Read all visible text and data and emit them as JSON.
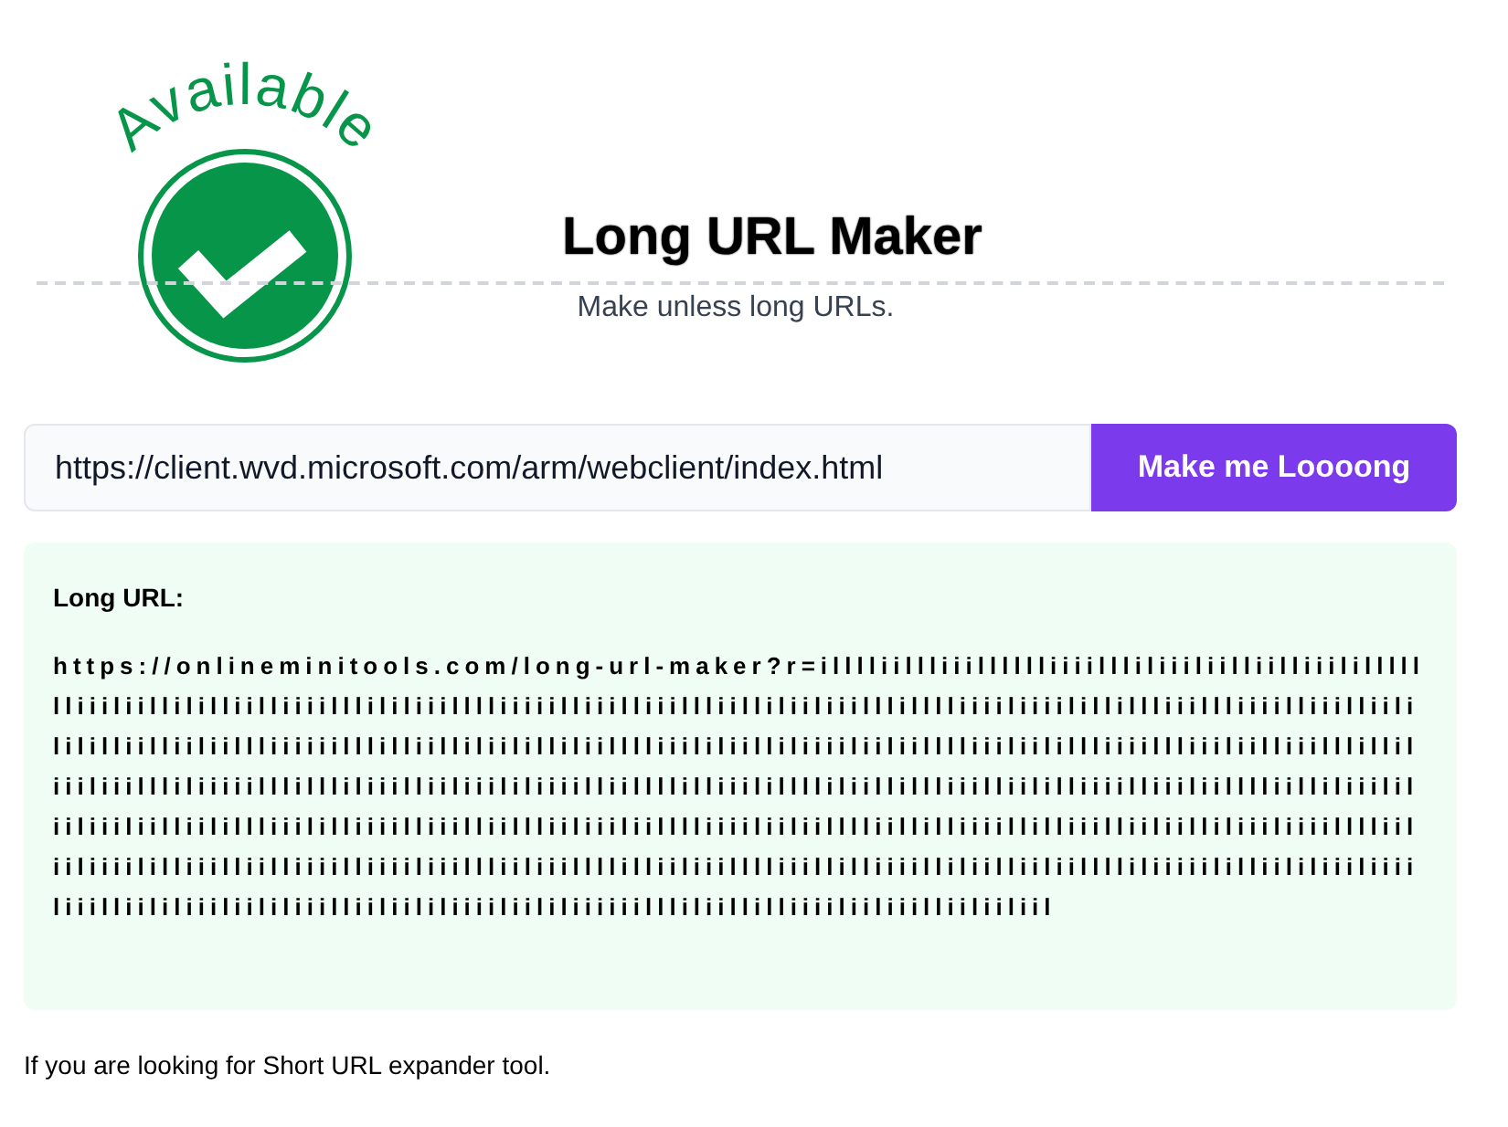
{
  "logo": {
    "text": "Available"
  },
  "header": {
    "title": "Long URL Maker",
    "subtitle": "Make unless long URLs."
  },
  "form": {
    "url_input": {
      "value": "https://client.wvd.microsoft.com/arm/webclient/index.html"
    },
    "submit_button": "Make me Loooong"
  },
  "result": {
    "label": "Long URL:",
    "value": "https://onlineminitools.com/long-url-maker?r=illlliillliiilllllliiiillliliiiliilliilliiilillllllliiiliillililliilliiiilllililiiilllliiiiilliiilliiillliilliliiliiilllilllliiiiliiiilillillliiillliiiilliiilliililililliilliiliillliiiiiilllilliilliliililliliilllliiililiilliliiiiliiliilllliiiliilillliiiillliiiliilliiilllilliliiiliiillliliiiiilllillliliiilliiliiililiiiilliillllilliiililllliliillillliiilliililliiiilliiiliilllliilliliiililiiliiiliilliilillliiililliiiilliiilliillliiliiiliilllliiiiliiliilllliillilliiiillilliiilliiliilliliiiliiiilllliiliiliiiililliiilliilliiiilliiiiliiillliiliiillllilliiliiilllliiillilliiiilliliilliiliilllliliiiiililliililiiiliiiiliiilliililiiiliililiiilliiliililiiiiliililiiiiiillliliillilliiiiliiliiilliiliiliil"
  },
  "footer": {
    "text": "If you are looking for Short URL expander tool."
  }
}
